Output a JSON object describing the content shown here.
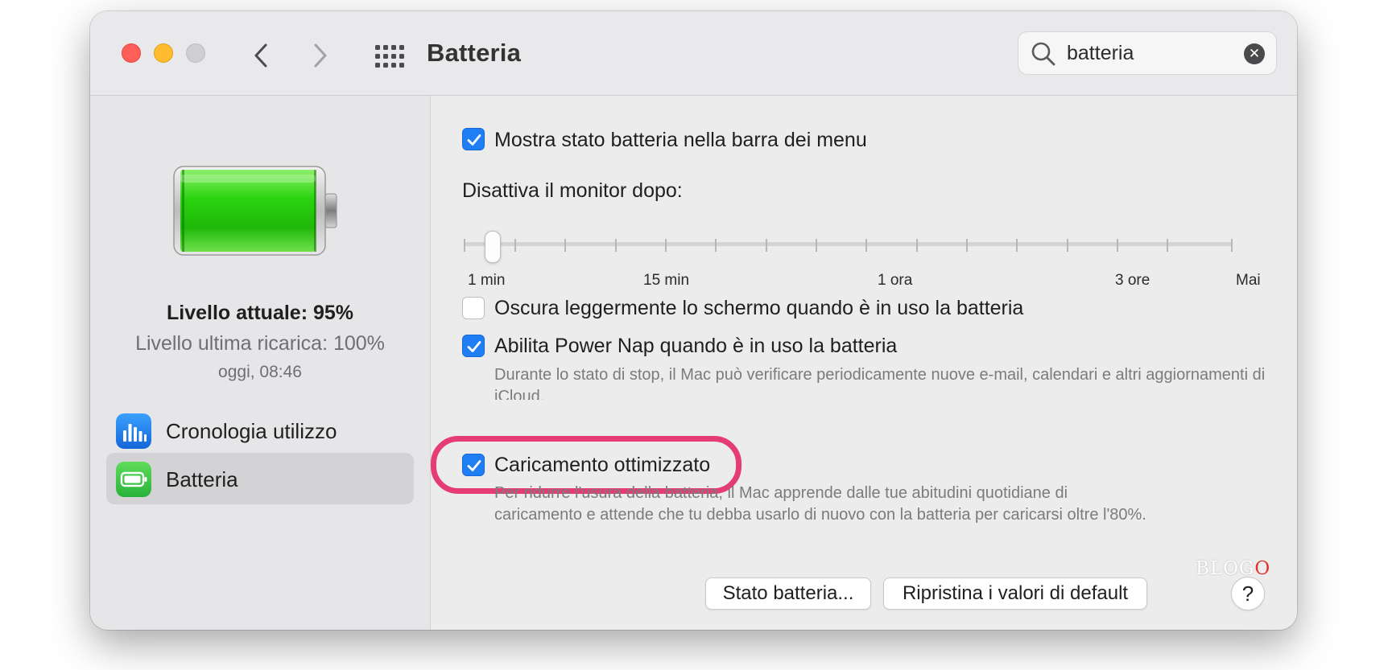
{
  "window": {
    "title": "Batteria"
  },
  "toolbar": {
    "back_icon": "chevron-left-icon",
    "forward_icon": "chevron-right-icon",
    "grid_icon": "grid-icon"
  },
  "search": {
    "value": "batteria",
    "clear_glyph": "✕"
  },
  "sidebar": {
    "current_level": "Livello attuale: 95%",
    "last_charge": "Livello ultima ricarica: 100%",
    "last_charge_time": "oggi, 08:46",
    "battery_fill": 0.95,
    "items": [
      {
        "label": "Cronologia utilizzo",
        "icon": "usage-history-icon",
        "selected": false
      },
      {
        "label": "Batteria",
        "icon": "battery-icon",
        "selected": true
      }
    ]
  },
  "options": {
    "show_status": {
      "label": "Mostra stato batteria nella barra dei menu",
      "checked": true
    },
    "monitor_off": {
      "label": "Disattiva il monitor dopo:",
      "ticks": [
        "1 min",
        "15 min",
        "1 ora",
        "3 ore",
        "Mai"
      ],
      "value": "2 min"
    },
    "dim_screen": {
      "label": "Oscura leggermente lo schermo quando è in uso la batteria",
      "checked": false
    },
    "power_nap": {
      "label": "Abilita Power Nap quando è in uso la batteria",
      "checked": true,
      "description": "Durante lo stato di stop, il Mac può verificare periodicamente nuove e-mail, calendari e altri aggiornamenti di iCloud."
    },
    "optimized_charging": {
      "label": "Caricamento ottimizzato",
      "checked": true,
      "description_line1": "Per ridurre l'usura della batteria, il Mac apprende dalle tue abitudini quotidiane di",
      "description_line2": "caricamento e attende che tu debba usarlo di nuovo con la batteria per caricarsi oltre l'80%."
    }
  },
  "buttons": {
    "battery_health": "Stato batteria...",
    "restore_defaults": "Ripristina i valori di default",
    "help": "?"
  },
  "watermark": {
    "text_main": "BLOG",
    "text_o": "O"
  },
  "colors": {
    "accent": "#1f7ef4",
    "highlight": "#e43c73",
    "battery_green": "#2bd40f"
  }
}
